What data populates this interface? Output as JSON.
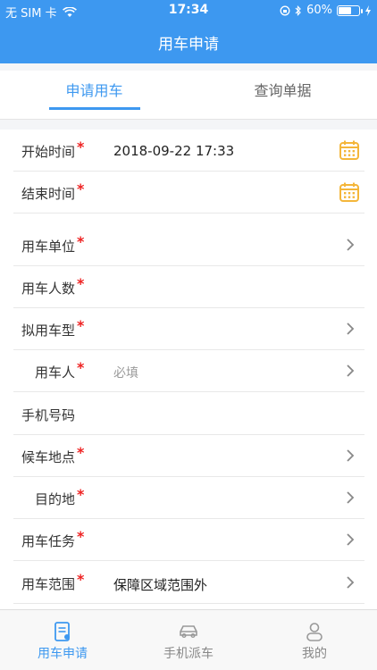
{
  "status_bar": {
    "carrier": "无 SIM 卡",
    "time": "17:34",
    "battery": "60%"
  },
  "nav": {
    "title": "用车申请"
  },
  "tabs": [
    {
      "label": "申请用车",
      "active": true
    },
    {
      "label": "查询单据",
      "active": false
    }
  ],
  "form": {
    "rows": [
      {
        "label": "开始时间",
        "required": true,
        "value": "2018-09-22 17:33",
        "icon": "calendar-icon"
      },
      {
        "label": "结束时间",
        "required": true,
        "value": "",
        "icon": "calendar-icon"
      },
      {
        "label": "用车单位",
        "required": true,
        "value": "",
        "icon": "chevron-right-icon"
      },
      {
        "label": "用车人数",
        "required": true,
        "value": ""
      },
      {
        "label": "拟用车型",
        "required": true,
        "value": "",
        "icon": "chevron-right-icon"
      },
      {
        "label": "用车人",
        "required": true,
        "placeholder": "必填",
        "icon": "chevron-right-icon"
      },
      {
        "label": "手机号码",
        "required": false,
        "value": ""
      },
      {
        "label": "候车地点",
        "required": true,
        "value": "",
        "icon": "chevron-right-icon"
      },
      {
        "label": "目的地",
        "required": true,
        "value": "",
        "icon": "chevron-right-icon"
      },
      {
        "label": "用车任务",
        "required": true,
        "value": "",
        "icon": "chevron-right-icon"
      },
      {
        "label": "用车范围",
        "required": true,
        "value": "保障区域范围外",
        "icon": "chevron-right-icon"
      }
    ],
    "required_mark": "*"
  },
  "bottom_tabs": [
    {
      "label": "用车申请",
      "active": true,
      "icon": "form-icon"
    },
    {
      "label": "手机派车",
      "active": false,
      "icon": "car-icon"
    },
    {
      "label": "我的",
      "active": false,
      "icon": "user-icon"
    }
  ],
  "colors": {
    "primary": "#3d98f0",
    "required": "#e22222",
    "calendar": "#f4b63a"
  }
}
